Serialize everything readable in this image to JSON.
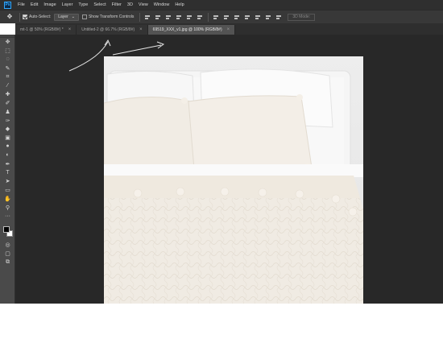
{
  "app": {
    "logo_text": "Ps",
    "menu": [
      "File",
      "Edit",
      "Image",
      "Layer",
      "Type",
      "Select",
      "Filter",
      "3D",
      "View",
      "Window",
      "Help"
    ]
  },
  "options": {
    "auto_select_label": "Auto-Select:",
    "auto_select_checked": true,
    "target_value": "Layer",
    "transform_controls_label": "Show Transform Controls",
    "transform_controls_checked": false,
    "mode_3d_label": "3D Mode:"
  },
  "tabs": [
    {
      "label": "mt-1 @ 50% (RGB/8#) *",
      "active": false
    },
    {
      "label": "Untitled-2 @ 66.7% (RGB/8#)",
      "active": false
    },
    {
      "label": "69519_XXX_v1.jpg @ 100% (RGB/8#)",
      "active": true
    }
  ],
  "tools": [
    "move-tool",
    "marquee-tool",
    "lasso-tool",
    "quick-select-tool",
    "crop-tool",
    "eyedropper-tool",
    "healing-tool",
    "brush-tool",
    "stamp-tool",
    "history-brush-tool",
    "eraser-tool",
    "gradient-tool",
    "blur-tool",
    "dodge-tool",
    "pen-tool",
    "type-tool",
    "path-select-tool",
    "rectangle-tool",
    "hand-tool",
    "zoom-tool",
    "more-tools"
  ],
  "colors": {
    "foreground": "#000000",
    "background": "#ffffff",
    "workspace": "#282828",
    "accent": "#31a8ff"
  }
}
